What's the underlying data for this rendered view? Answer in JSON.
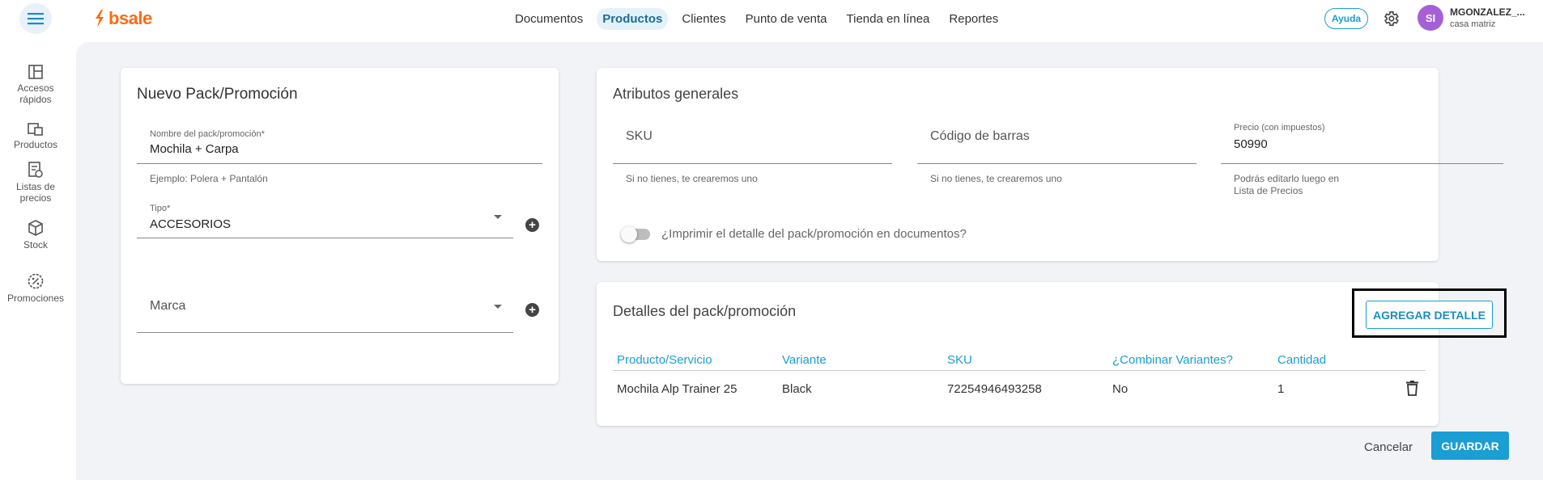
{
  "brand": {
    "name": "bsale",
    "accent": "#ff6a14"
  },
  "nav": {
    "items": [
      {
        "label": "Documentos",
        "active": false
      },
      {
        "label": "Productos",
        "active": true
      },
      {
        "label": "Clientes",
        "active": false
      },
      {
        "label": "Punto de venta",
        "active": false
      },
      {
        "label": "Tienda en línea",
        "active": false
      },
      {
        "label": "Reportes",
        "active": false
      }
    ],
    "help_label": "Ayuda",
    "user": {
      "initials": "SI",
      "name": "MGONZALEZ_...",
      "branch": "casa matriz"
    }
  },
  "sidebar": {
    "items": [
      {
        "label_line1": "Accesos",
        "label_line2": "rápidos",
        "icon": "layout-icon"
      },
      {
        "label_line1": "Productos",
        "label_line2": "",
        "icon": "products-icon"
      },
      {
        "label_line1": "Listas de",
        "label_line2": "precios",
        "icon": "price-list-icon"
      },
      {
        "label_line1": "Stock",
        "label_line2": "",
        "icon": "box-icon"
      },
      {
        "label_line1": "Promociones",
        "label_line2": "",
        "icon": "promo-icon"
      }
    ]
  },
  "pack_form": {
    "title": "Nuevo Pack/Promoción",
    "name_label": "Nombre del pack/promoción*",
    "name_value": "Mochila + Carpa",
    "name_helper": "Ejemplo: Polera + Pantalón",
    "type_label": "Tipo*",
    "type_value": "ACCESORIOS",
    "brand_placeholder": "Marca"
  },
  "attributes": {
    "title": "Atributos generales",
    "sku_placeholder": "SKU",
    "sku_helper": "Si no tienes, te crearemos uno",
    "barcode_placeholder": "Código de barras",
    "barcode_helper": "Si no tienes, te crearemos uno",
    "price_label": "Precio (con impuestos)",
    "price_value": "50990",
    "price_helper_line1": "Podrás editarlo luego en",
    "price_helper_line2": "Lista de Precios",
    "print_toggle_label": "¿Imprimir el detalle del pack/promoción en documentos?",
    "print_toggle_on": false
  },
  "details": {
    "title": "Detalles del pack/promoción",
    "add_button": "AGREGAR DETALLE",
    "columns": [
      "Producto/Servicio",
      "Variante",
      "SKU",
      "¿Combinar Variantes?",
      "Cantidad"
    ],
    "rows": [
      {
        "product": "Mochila Alp Trainer 25",
        "variant": "Black",
        "sku": "72254946493258",
        "combine": "No",
        "quantity": "1"
      }
    ]
  },
  "actions": {
    "cancel_label": "Cancelar",
    "save_label": "GUARDAR"
  }
}
